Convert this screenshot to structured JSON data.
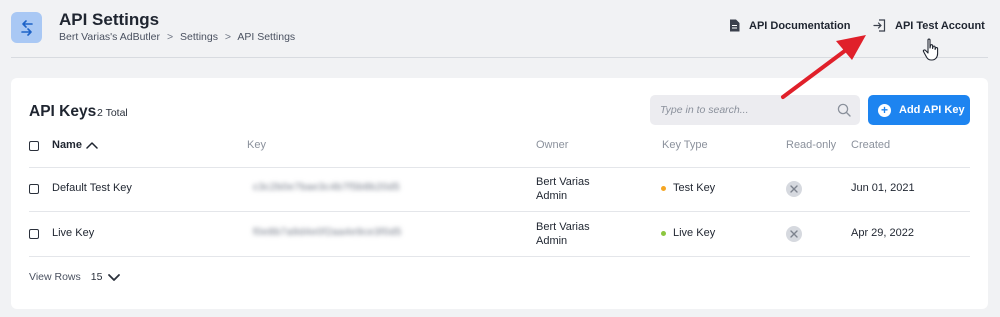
{
  "header": {
    "title": "API Settings",
    "breadcrumb": [
      "Bert Varias's AdButler",
      "Settings",
      "API Settings"
    ],
    "breadcrumb_separator": ">",
    "links": {
      "docs": "API Documentation",
      "test_account": "API Test Account"
    }
  },
  "card": {
    "title": "API Keys",
    "count": "2 Total",
    "search_placeholder": "Type in to search...",
    "add_button": "Add API Key",
    "columns": {
      "name": "Name",
      "key": "Key",
      "owner": "Owner",
      "key_type": "Key Type",
      "read_only": "Read-only",
      "created": "Created"
    },
    "rows": [
      {
        "name": "Default Test Key",
        "key": "c3c2b0e7bae3c4b7f5b8b20d5",
        "owner_line1": "Bert Varias",
        "owner_line2": "Admin",
        "key_type": "Test Key",
        "key_type_color": "#f5a623",
        "created": "Jun 01, 2021"
      },
      {
        "name": "Live Key",
        "key": "f0e8b7a9d4e0f2aa4e9ce3f0d5",
        "owner_line1": "Bert Varias",
        "owner_line2": "Admin",
        "key_type": "Live Key",
        "key_type_color": "#8cc63f",
        "created": "Apr 29, 2022"
      }
    ],
    "view_rows_label": "View Rows",
    "view_rows_value": "15"
  },
  "colors": {
    "accent": "#1d84f0",
    "annotation_arrow": "#e0202a"
  }
}
